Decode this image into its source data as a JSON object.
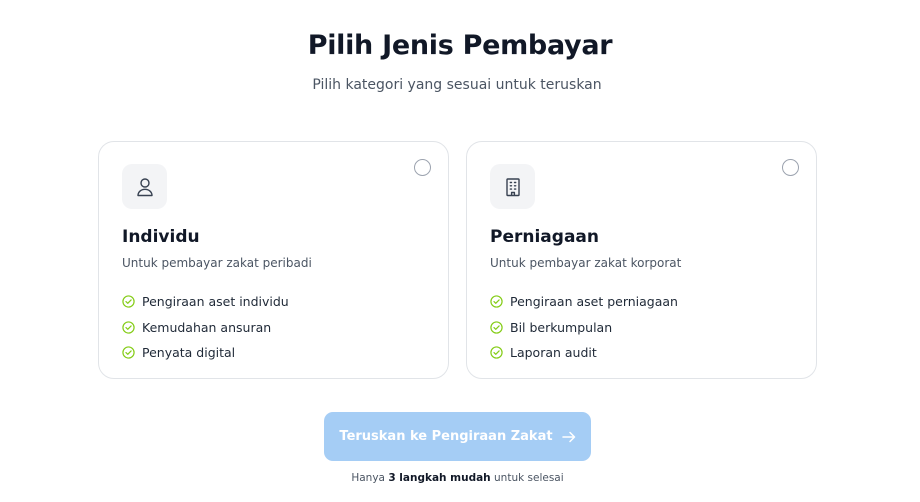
{
  "header": {
    "title": "Pilih Jenis Pembayar",
    "subtitle": "Pilih kategori yang sesuai untuk teruskan"
  },
  "options": [
    {
      "title": "Individu",
      "description": "Untuk pembayar zakat peribadi",
      "icon": "user-icon",
      "selected": false,
      "features": [
        "Pengiraan aset individu",
        "Kemudahan ansuran",
        "Penyata digital"
      ]
    },
    {
      "title": "Perniagaan",
      "description": "Untuk pembayar zakat korporat",
      "icon": "building-icon",
      "selected": false,
      "features": [
        "Pengiraan aset perniagaan",
        "Bil berkumpulan",
        "Laporan audit"
      ]
    }
  ],
  "cta": {
    "label": "Teruskan ke Pengiraan Zakat",
    "icon": "arrow-right-icon",
    "disabled": true
  },
  "footnote": {
    "prefix": "Hanya",
    "highlight": "3 langkah mudah",
    "suffix": "untuk selesai"
  },
  "colors": {
    "check": "#84cc16",
    "button_disabled": "#a5cdf5",
    "title": "#111827"
  }
}
